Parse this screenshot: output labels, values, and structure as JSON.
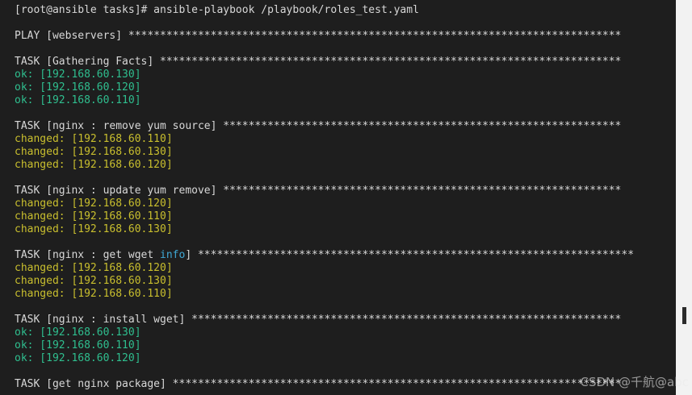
{
  "terminal": {
    "stars_play": "******************************************************************************",
    "stars_gather": "*****************************************************************************",
    "stars_remove": "**********************************************************************",
    "stars_update": "**********************************************************************",
    "stars_wget": "**************************************************************************",
    "stars_install": "*************************************************************************",
    "stars_package": "******************************************************************************",
    "lines": [
      {
        "segments": [
          {
            "text": "[root@ansible tasks]# ansible-playbook /playbook/roles_test.yaml",
            "style": "default"
          }
        ]
      },
      {
        "segments": [
          {
            "text": "",
            "style": "default"
          }
        ]
      },
      {
        "segments": [
          {
            "text": "PLAY [webservers] ",
            "style": "default"
          },
          {
            "text": "******************************************************************************",
            "style": "default"
          }
        ]
      },
      {
        "segments": [
          {
            "text": "",
            "style": "default"
          }
        ]
      },
      {
        "segments": [
          {
            "text": "TASK [Gathering Facts] ",
            "style": "default"
          },
          {
            "text": "*************************************************************************",
            "style": "default"
          }
        ]
      },
      {
        "segments": [
          {
            "text": "ok: [192.168.60.130]",
            "style": "ok"
          }
        ]
      },
      {
        "segments": [
          {
            "text": "ok: [192.168.60.120]",
            "style": "ok"
          }
        ]
      },
      {
        "segments": [
          {
            "text": "ok: [192.168.60.110]",
            "style": "ok"
          }
        ]
      },
      {
        "segments": [
          {
            "text": "",
            "style": "default"
          }
        ]
      },
      {
        "segments": [
          {
            "text": "TASK [nginx : remove yum source] ",
            "style": "default"
          },
          {
            "text": "***************************************************************",
            "style": "default"
          }
        ]
      },
      {
        "segments": [
          {
            "text": "changed: [192.168.60.110]",
            "style": "changed"
          }
        ]
      },
      {
        "segments": [
          {
            "text": "changed: [192.168.60.130]",
            "style": "changed"
          }
        ]
      },
      {
        "segments": [
          {
            "text": "changed: [192.168.60.120]",
            "style": "changed"
          }
        ]
      },
      {
        "segments": [
          {
            "text": "",
            "style": "default"
          }
        ]
      },
      {
        "segments": [
          {
            "text": "TASK [nginx : update yum remove] ",
            "style": "default"
          },
          {
            "text": "***************************************************************",
            "style": "default"
          }
        ]
      },
      {
        "segments": [
          {
            "text": "changed: [192.168.60.120]",
            "style": "changed"
          }
        ]
      },
      {
        "segments": [
          {
            "text": "changed: [192.168.60.110]",
            "style": "changed"
          }
        ]
      },
      {
        "segments": [
          {
            "text": "changed: [192.168.60.130]",
            "style": "changed"
          }
        ]
      },
      {
        "segments": [
          {
            "text": "",
            "style": "default"
          }
        ]
      },
      {
        "segments": [
          {
            "text": "TASK [nginx : get wget ",
            "style": "default"
          },
          {
            "text": "info",
            "style": "hl"
          },
          {
            "text": "] ",
            "style": "default"
          },
          {
            "text": "*********************************************************************",
            "style": "default"
          }
        ]
      },
      {
        "segments": [
          {
            "text": "changed: [192.168.60.120]",
            "style": "changed"
          }
        ]
      },
      {
        "segments": [
          {
            "text": "changed: [192.168.60.130]",
            "style": "changed"
          }
        ]
      },
      {
        "segments": [
          {
            "text": "changed: [192.168.60.110]",
            "style": "changed"
          }
        ]
      },
      {
        "segments": [
          {
            "text": "",
            "style": "default"
          }
        ]
      },
      {
        "segments": [
          {
            "text": "TASK [nginx : install wget] ",
            "style": "default"
          },
          {
            "text": "********************************************************************",
            "style": "default"
          }
        ]
      },
      {
        "segments": [
          {
            "text": "ok: [192.168.60.130]",
            "style": "ok"
          }
        ]
      },
      {
        "segments": [
          {
            "text": "ok: [192.168.60.110]",
            "style": "ok"
          }
        ]
      },
      {
        "segments": [
          {
            "text": "ok: [192.168.60.120]",
            "style": "ok"
          }
        ]
      },
      {
        "segments": [
          {
            "text": "",
            "style": "default"
          }
        ]
      },
      {
        "segments": [
          {
            "text": "TASK [get nginx package] ",
            "style": "default"
          },
          {
            "text": "***********************************************************************",
            "style": "default"
          }
        ]
      }
    ]
  },
  "watermark": "CSDN @千航@abc"
}
